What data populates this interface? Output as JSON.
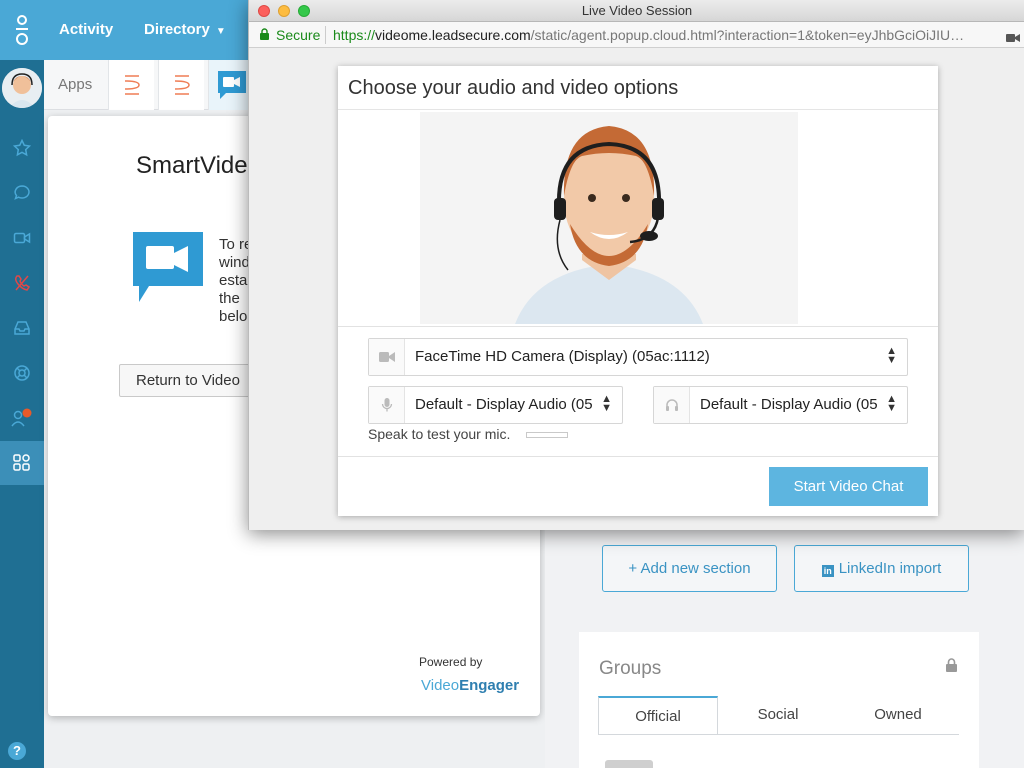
{
  "topbar": {
    "nav": [
      "Activity",
      "Directory"
    ]
  },
  "apps": {
    "label": "Apps"
  },
  "app_card": {
    "title": "SmartVide",
    "description_lines": [
      "To re",
      "wind",
      "esta",
      "the",
      "belo"
    ],
    "return_button": "Return to Video",
    "powered_by": "Powered by",
    "brand_a": "Video",
    "brand_b": "Engager"
  },
  "right_panel": {
    "add_section": "+ Add new section",
    "linkedin_import": "LinkedIn import",
    "groups_title": "Groups",
    "group_tabs": [
      "Official",
      "Social",
      "Owned"
    ]
  },
  "help": "?",
  "window": {
    "title": "Live Video Session",
    "secure": "Secure",
    "url_scheme": "https://",
    "url_host": "videome.leadsecure.com",
    "url_path": "/static/agent.popup.cloud.html?interaction=1&token=eyJhbGciOiJIU…"
  },
  "dialog": {
    "title": "Choose your audio and video options",
    "camera_select": "FaceTime HD Camera (Display) (05ac:1112)",
    "mic_select": "Default - Display Audio (05",
    "speaker_select": "Default - Display Audio (05",
    "mic_test": "Speak to test your mic.",
    "mic_level": 0,
    "start_button": "Start Video Chat"
  },
  "colors": {
    "accent": "#4aa8d6",
    "rail": "#1f6f93",
    "start_button": "#5db5e0"
  }
}
